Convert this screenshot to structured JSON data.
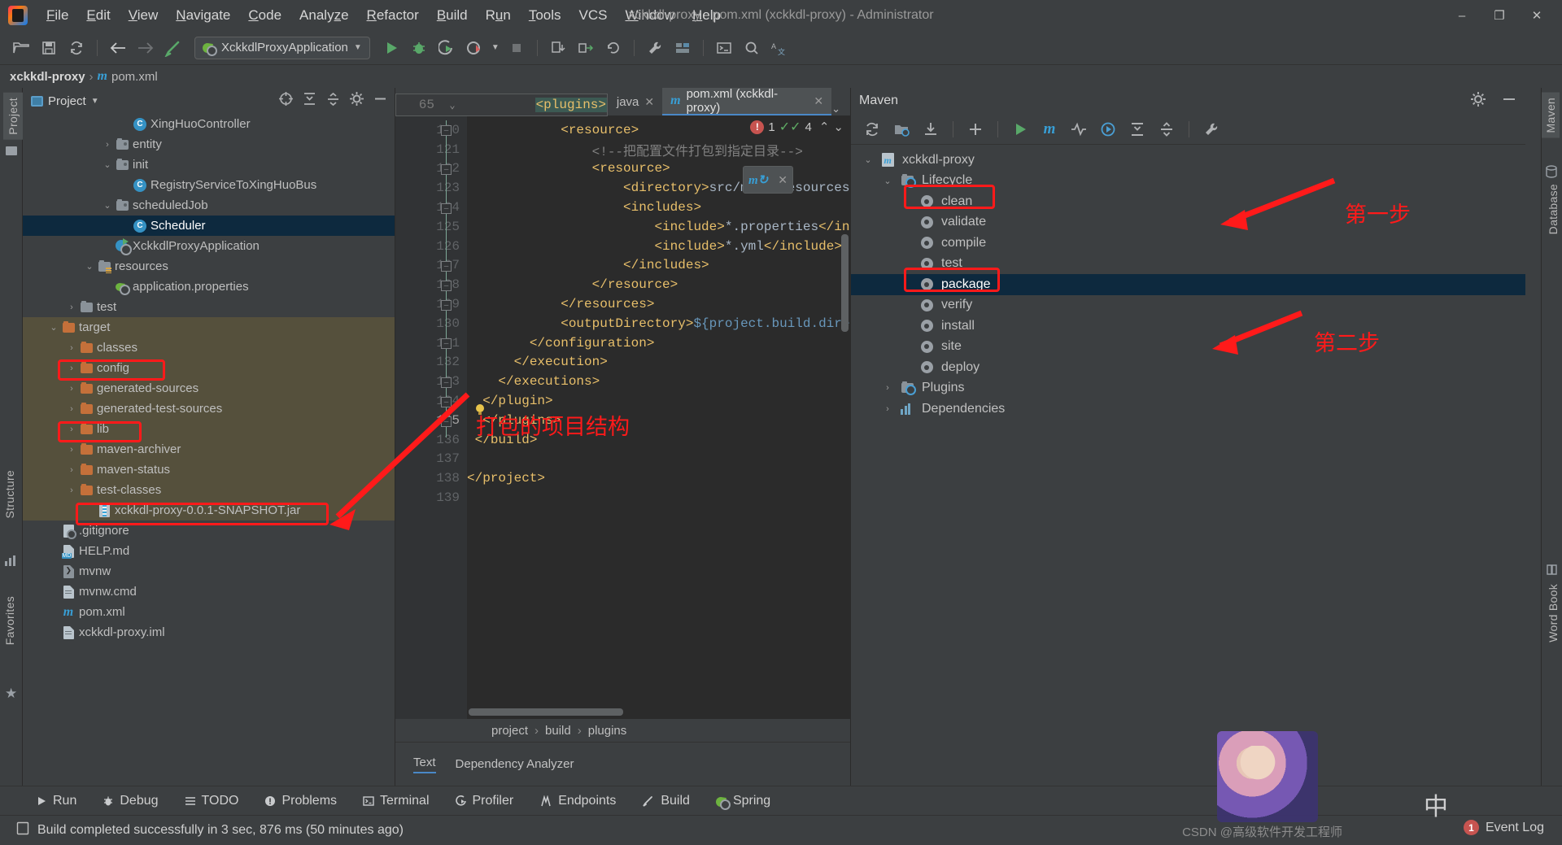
{
  "window": {
    "title": "xckkdl-proxy - pom.xml (xckkdl-proxy) - Administrator",
    "minimize": "–",
    "maximize": "❐",
    "close": "✕"
  },
  "menu": [
    {
      "label": "File"
    },
    {
      "label": "Edit"
    },
    {
      "label": "View"
    },
    {
      "label": "Navigate"
    },
    {
      "label": "Code"
    },
    {
      "label": "Analyze"
    },
    {
      "label": "Refactor"
    },
    {
      "label": "Build"
    },
    {
      "label": "Run"
    },
    {
      "label": "Tools"
    },
    {
      "label": "VCS"
    },
    {
      "label": "Window"
    },
    {
      "label": "Help"
    }
  ],
  "toolbar": {
    "run_configuration": "XckkdlProxyApplication",
    "dropdown_caret": "▼"
  },
  "breadcrumb_top": {
    "project": "xckkdl-proxy",
    "separator": "›",
    "file": "pom.xml"
  },
  "left_strip": {
    "project_tab": "Project",
    "structure_tab": "Structure",
    "favorites_tab": "Favorites"
  },
  "right_strip": {
    "maven_tab": "Maven",
    "database_tab": "Database",
    "word_book_tab": "Word Book"
  },
  "project_panel": {
    "title": "Project",
    "caret": "▼",
    "tree": [
      {
        "indent": 5,
        "arrow": "",
        "icon": "class-icon",
        "label": "XingHuoController",
        "selected": false,
        "target": false
      },
      {
        "indent": 4,
        "arrow": "›",
        "icon": "folder-src-icon",
        "label": "entity",
        "selected": false,
        "target": false
      },
      {
        "indent": 4,
        "arrow": "⌄",
        "icon": "folder-src-icon",
        "label": "init",
        "selected": false,
        "target": false
      },
      {
        "indent": 5,
        "arrow": "",
        "icon": "class-icon",
        "label": "RegistryServiceToXingHuoBus",
        "selected": false,
        "target": false
      },
      {
        "indent": 4,
        "arrow": "⌄",
        "icon": "folder-src-icon",
        "label": "scheduledJob",
        "selected": false,
        "target": false
      },
      {
        "indent": 5,
        "arrow": "",
        "icon": "class-icon",
        "label": "Scheduler",
        "selected": true,
        "target": false
      },
      {
        "indent": 4,
        "arrow": "",
        "icon": "spring-app-icon",
        "label": "XckkdlProxyApplication",
        "selected": false,
        "target": false
      },
      {
        "indent": 3,
        "arrow": "⌄",
        "icon": "folder-resources-icon",
        "label": "resources",
        "selected": false,
        "target": false
      },
      {
        "indent": 4,
        "arrow": "",
        "icon": "spring-properties-icon",
        "label": "application.properties",
        "selected": false,
        "target": false
      },
      {
        "indent": 2,
        "arrow": "›",
        "icon": "folder-icon",
        "label": "test",
        "selected": false,
        "target": false
      },
      {
        "indent": 1,
        "arrow": "⌄",
        "icon": "folder-orange-icon",
        "label": "target",
        "selected": false,
        "target": true
      },
      {
        "indent": 2,
        "arrow": "›",
        "icon": "folder-orange-icon",
        "label": "classes",
        "selected": false,
        "target": true
      },
      {
        "indent": 2,
        "arrow": "›",
        "icon": "folder-orange-icon",
        "label": "config",
        "selected": false,
        "target": true
      },
      {
        "indent": 2,
        "arrow": "›",
        "icon": "folder-orange-icon",
        "label": "generated-sources",
        "selected": false,
        "target": true
      },
      {
        "indent": 2,
        "arrow": "›",
        "icon": "folder-orange-icon",
        "label": "generated-test-sources",
        "selected": false,
        "target": true
      },
      {
        "indent": 2,
        "arrow": "›",
        "icon": "folder-orange-icon",
        "label": "lib",
        "selected": false,
        "target": true
      },
      {
        "indent": 2,
        "arrow": "›",
        "icon": "folder-orange-icon",
        "label": "maven-archiver",
        "selected": false,
        "target": true
      },
      {
        "indent": 2,
        "arrow": "›",
        "icon": "folder-orange-icon",
        "label": "maven-status",
        "selected": false,
        "target": true
      },
      {
        "indent": 2,
        "arrow": "›",
        "icon": "folder-orange-icon",
        "label": "test-classes",
        "selected": false,
        "target": true
      },
      {
        "indent": 3,
        "arrow": "",
        "icon": "jar-icon",
        "label": "xckkdl-proxy-0.0.1-SNAPSHOT.jar",
        "selected": false,
        "target": true
      },
      {
        "indent": 1,
        "arrow": "",
        "icon": "gitignore-icon",
        "label": ".gitignore",
        "selected": false,
        "target": false
      },
      {
        "indent": 1,
        "arrow": "",
        "icon": "markdown-icon",
        "label": "HELP.md",
        "selected": false,
        "target": false
      },
      {
        "indent": 1,
        "arrow": "",
        "icon": "shell-icon",
        "label": "mvnw",
        "selected": false,
        "target": false
      },
      {
        "indent": 1,
        "arrow": "",
        "icon": "file-icon",
        "label": "mvnw.cmd",
        "selected": false,
        "target": false
      },
      {
        "indent": 1,
        "arrow": "",
        "icon": "maven-icon",
        "label": "pom.xml",
        "selected": false,
        "target": false
      },
      {
        "indent": 1,
        "arrow": "",
        "icon": "file-icon",
        "label": "xckkdl-proxy.iml",
        "selected": false,
        "target": false
      }
    ]
  },
  "editor": {
    "sticky_header": {
      "line": "65",
      "fold": "⌄",
      "code": "<plugins>"
    },
    "tabs": [
      {
        "label": "java",
        "active": false,
        "close": "✕",
        "icon": ""
      },
      {
        "label": "pom.xml (xckkdl-proxy)",
        "active": true,
        "close": "✕",
        "icon": "maven-icon"
      }
    ],
    "tab_overflow": "⌄",
    "inspection": {
      "error_count": "1",
      "warning_count": "4",
      "up": "⌃",
      "down": "⌄"
    },
    "first_line": 120,
    "lines": [
      {
        "no": 120,
        "text": "            <resource>",
        "indent": 12
      },
      {
        "no": 121,
        "text": "                <!--把配置文件打包到指定目录-->",
        "indent": 16
      },
      {
        "no": 122,
        "text": "                <resource>",
        "indent": 16
      },
      {
        "no": 123,
        "text": "                    <directory>src/main/resources</directory>",
        "indent": 20
      },
      {
        "no": 124,
        "text": "                    <includes>",
        "indent": 20
      },
      {
        "no": 125,
        "text": "                        <include>*.properties</include>",
        "indent": 24
      },
      {
        "no": 126,
        "text": "                        <include>*.yml</include>",
        "indent": 24
      },
      {
        "no": 127,
        "text": "                    </includes>",
        "indent": 20
      },
      {
        "no": 128,
        "text": "                </resource>",
        "indent": 16
      },
      {
        "no": 129,
        "text": "            </resources>",
        "indent": 12
      },
      {
        "no": 130,
        "text": "            <outputDirectory>${project.build.directory}</outputDirectory>",
        "indent": 12
      },
      {
        "no": 131,
        "text": "        </configuration>",
        "indent": 8
      },
      {
        "no": 132,
        "text": "      </execution>",
        "indent": 6
      },
      {
        "no": 133,
        "text": "    </executions>",
        "indent": 4
      },
      {
        "no": 134,
        "text": "  </plugin>",
        "indent": 2
      },
      {
        "no": 135,
        "text": "  </plugins>",
        "indent": 2
      },
      {
        "no": 136,
        "text": " </build>",
        "indent": 1
      },
      {
        "no": 137,
        "text": "",
        "indent": 0
      },
      {
        "no": 138,
        "text": "</project>",
        "indent": 0
      },
      {
        "no": 139,
        "text": "",
        "indent": 0
      }
    ],
    "bulb_line": 135,
    "breadcrumb": [
      "project",
      "build",
      "plugins"
    ],
    "breadcrumb_sep": "›",
    "bottom_tabs": [
      {
        "label": "Text",
        "active": true
      },
      {
        "label": "Dependency Analyzer",
        "active": false
      }
    ]
  },
  "maven_panel": {
    "title": "Maven",
    "toolbar_icons": [
      "refresh-icon",
      "add-maven-project-icon",
      "download-sources-icon",
      "plus-icon",
      "run-icon",
      "maven-goal-icon",
      "toggle-skip-tests-icon",
      "execute-icon",
      "expand-all-icon",
      "collapse-all-icon",
      "settings-icon"
    ],
    "tree": [
      {
        "indent": 0,
        "arrow": "⌄",
        "icon": "maven-project-icon",
        "label": "xckkdl-proxy",
        "selected": false
      },
      {
        "indent": 1,
        "arrow": "⌄",
        "icon": "lifecycle-folder-icon",
        "label": "Lifecycle",
        "selected": false
      },
      {
        "indent": 2,
        "arrow": "",
        "icon": "gear-icon",
        "label": "clean",
        "selected": false
      },
      {
        "indent": 2,
        "arrow": "",
        "icon": "gear-icon",
        "label": "validate",
        "selected": false
      },
      {
        "indent": 2,
        "arrow": "",
        "icon": "gear-icon",
        "label": "compile",
        "selected": false
      },
      {
        "indent": 2,
        "arrow": "",
        "icon": "gear-icon",
        "label": "test",
        "selected": false
      },
      {
        "indent": 2,
        "arrow": "",
        "icon": "gear-icon",
        "label": "package",
        "selected": true
      },
      {
        "indent": 2,
        "arrow": "",
        "icon": "gear-icon",
        "label": "verify",
        "selected": false
      },
      {
        "indent": 2,
        "arrow": "",
        "icon": "gear-icon",
        "label": "install",
        "selected": false
      },
      {
        "indent": 2,
        "arrow": "",
        "icon": "gear-icon",
        "label": "site",
        "selected": false
      },
      {
        "indent": 2,
        "arrow": "",
        "icon": "gear-icon",
        "label": "deploy",
        "selected": false
      },
      {
        "indent": 1,
        "arrow": "›",
        "icon": "plugins-folder-icon",
        "label": "Plugins",
        "selected": false
      },
      {
        "indent": 1,
        "arrow": "›",
        "icon": "dependencies-icon",
        "label": "Dependencies",
        "selected": false
      }
    ]
  },
  "annotations": {
    "step_one": "第一步",
    "step_two": "第二步",
    "package_structure": "打包的项目结构"
  },
  "bottom_bar": [
    {
      "label": "Run",
      "icon": "run-icon"
    },
    {
      "label": "Debug",
      "icon": "debug-icon"
    },
    {
      "label": "TODO",
      "icon": "todo-icon"
    },
    {
      "label": "Problems",
      "icon": "problems-icon"
    },
    {
      "label": "Terminal",
      "icon": "terminal-icon"
    },
    {
      "label": "Profiler",
      "icon": "profiler-icon"
    },
    {
      "label": "Endpoints",
      "icon": "endpoints-icon"
    },
    {
      "label": "Build",
      "icon": "build-icon"
    },
    {
      "label": "Spring",
      "icon": "spring-icon"
    }
  ],
  "status_bar": {
    "message": "Build completed successfully in 3 sec, 876 ms (50 minutes ago)",
    "event_log_label": "Event Log",
    "event_log_count": "1"
  },
  "watermark": {
    "text": "CSDN @高级软件开发工程师",
    "overlay_char": "中"
  },
  "colors": {
    "accent_blue": "#4a88c7",
    "selection": "#0d293e",
    "target_bg": "#55503c",
    "annotation_red": "#ff1a1a",
    "xml_tag": "#e8bf6a",
    "xml_value": "#a9b7c6",
    "comment_gray": "#808080"
  }
}
